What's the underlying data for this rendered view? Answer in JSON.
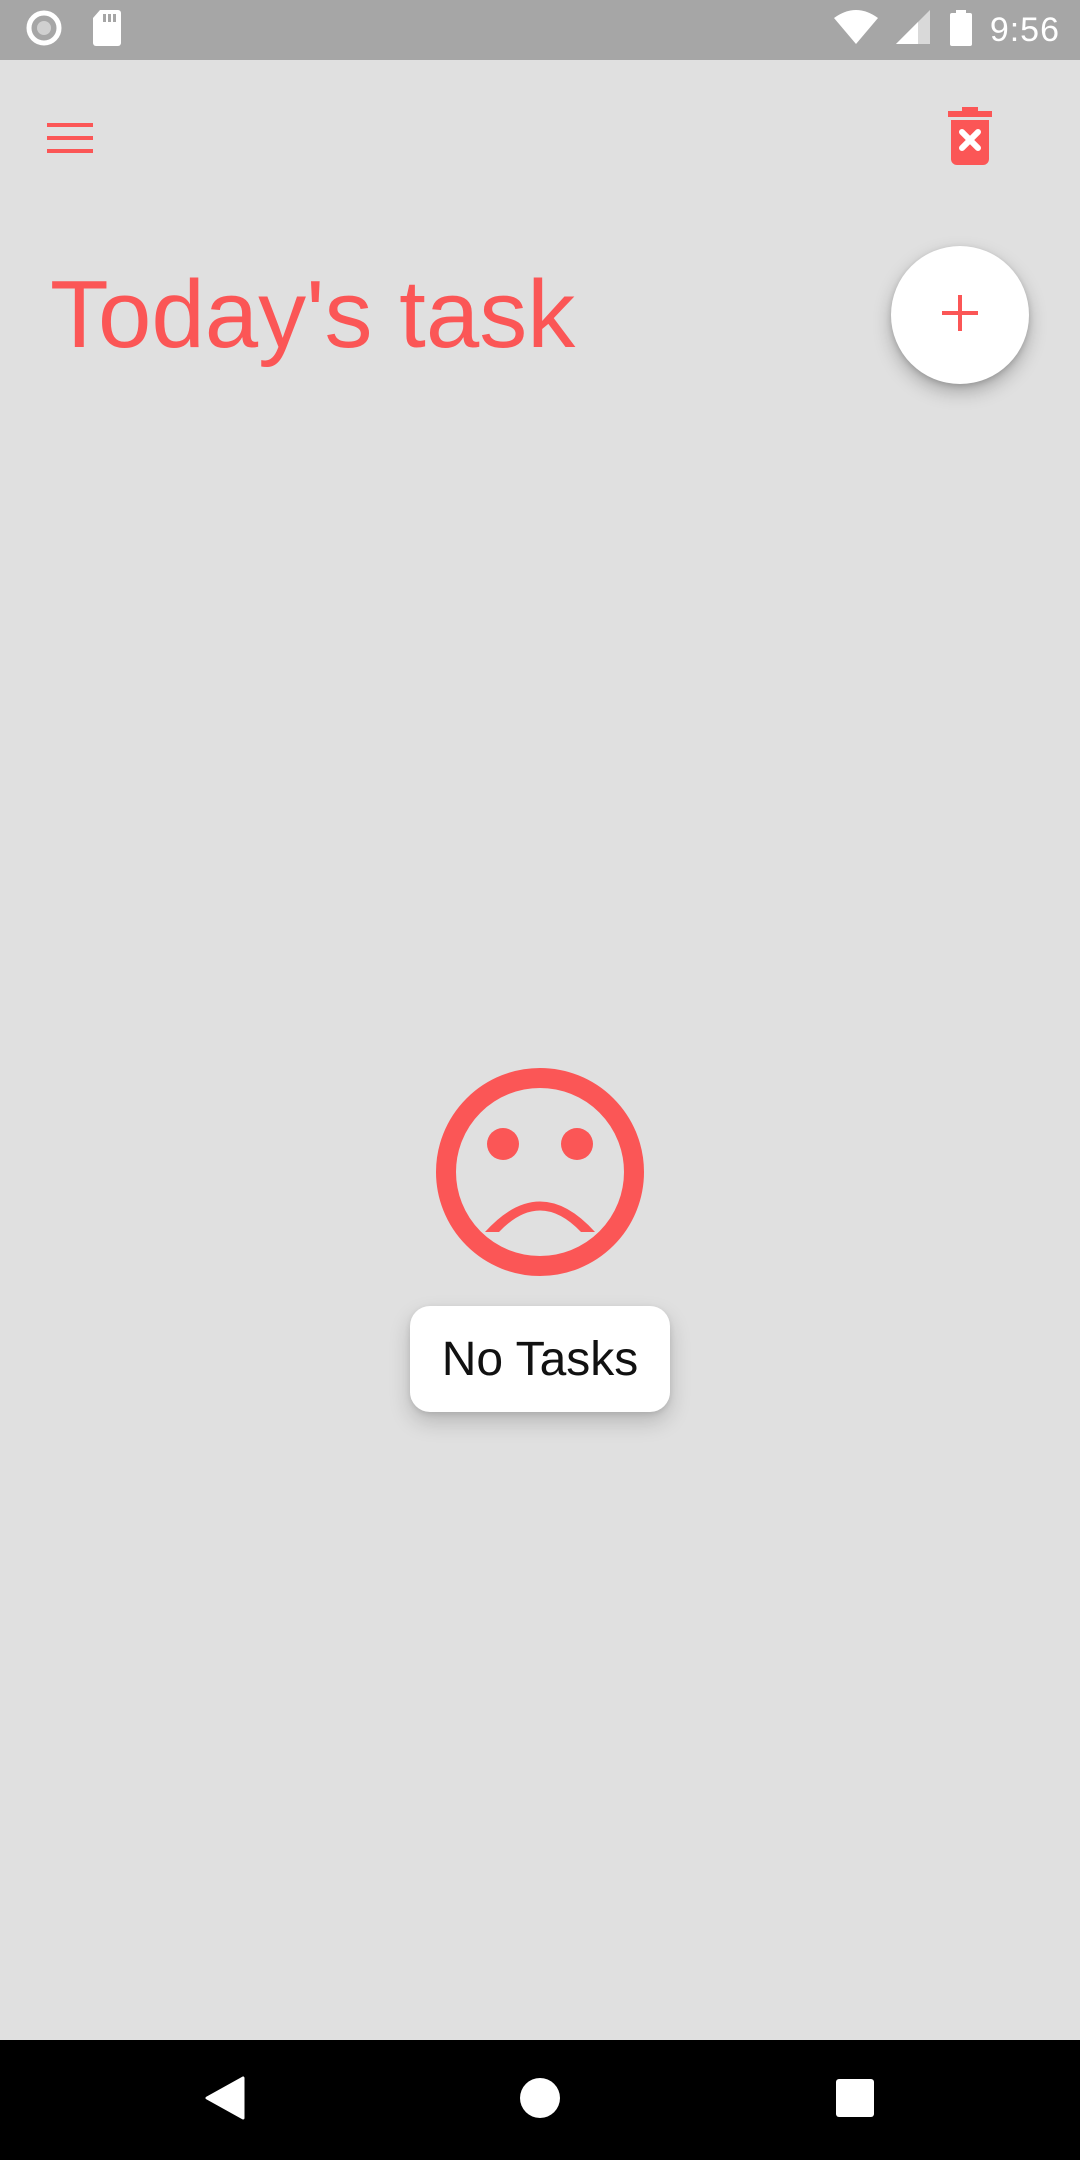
{
  "status_bar": {
    "time": "9:56",
    "left_icons": [
      "record-icon",
      "sd-card-icon"
    ],
    "right_icons": [
      "wifi-icon",
      "signal-icon",
      "battery-icon"
    ]
  },
  "toolbar": {
    "menu_icon": "hamburger-menu-icon",
    "trash_icon": "delete-all-icon"
  },
  "header": {
    "title": "Today's task",
    "add_icon": "plus-icon"
  },
  "empty_state": {
    "icon": "sad-face-icon",
    "label": "No Tasks"
  },
  "nav_bar": {
    "buttons": [
      "back-icon",
      "home-icon",
      "recents-icon"
    ]
  },
  "colors": {
    "accent": "#fb5656",
    "background": "#e0e0e0",
    "status_bar": "#a6a6a6",
    "nav_bar": "#000000",
    "card": "#ffffff"
  }
}
